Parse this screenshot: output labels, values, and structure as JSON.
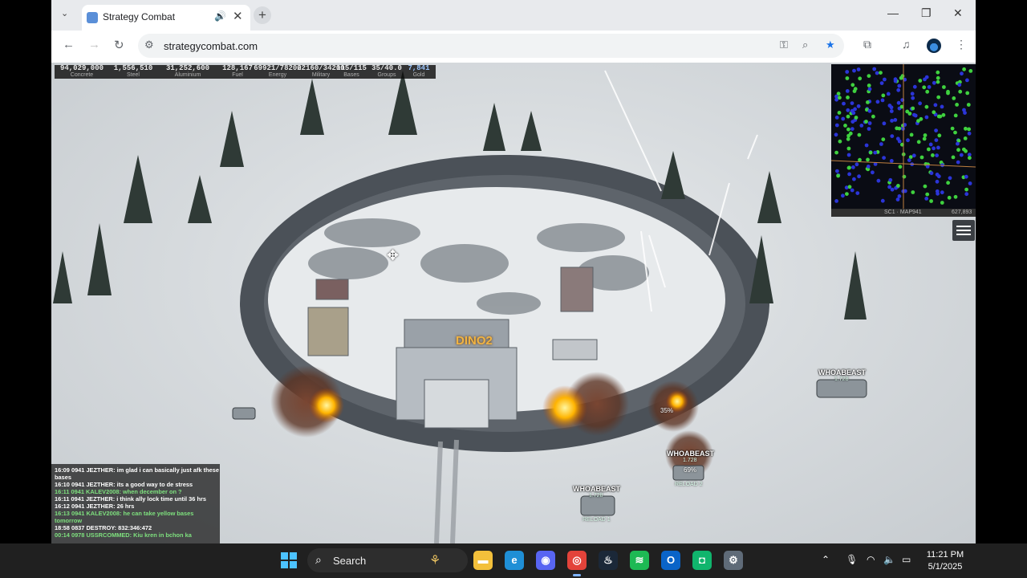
{
  "browser": {
    "tab": {
      "title": "Strategy Combat",
      "mute_icon": "speaker-icon",
      "close_glyph": "✕"
    },
    "new_tab_glyph": "+",
    "window_controls": {
      "minimize": "—",
      "restore": "❐",
      "close": "✕"
    },
    "url": "strategycombat.com"
  },
  "hud": {
    "resources": [
      {
        "value": "94,029,000",
        "label": "Concrete"
      },
      {
        "value": "1,556,510",
        "label": "Steel"
      },
      {
        "value": "31,252,600",
        "label": "Aluminium"
      },
      {
        "value": "128,167",
        "label": "Fuel"
      },
      {
        "value": "69921/78200",
        "label": "Energy"
      },
      {
        "value": "22160/34200",
        "label": "Military"
      },
      {
        "value": "115/115",
        "label": "Bases"
      },
      {
        "value": "35/40.0",
        "label": "Groups"
      },
      {
        "value": "7,841",
        "label": "Gold"
      }
    ]
  },
  "minimap": {
    "footer_left": "SC1 · MAP941",
    "footer_right": "627,893"
  },
  "chat": {
    "lines": [
      {
        "text": "16:09 0941 JEZTHER: im glad i can basically just afk these bases",
        "color": "#ffffff"
      },
      {
        "text": "16:10 0941 JEZTHER: its a good way to de stress",
        "color": "#ffffff"
      },
      {
        "text": "16:11 0941 KALEV2008: when december on ?",
        "color": "#7ee07e"
      },
      {
        "text": "16:11 0941 JEZTHER: i think ally lock time until 36 hrs",
        "color": "#ffffff"
      },
      {
        "text": "16:12 0941 JEZTHER: 26 hrs",
        "color": "#ffffff"
      },
      {
        "text": "16:13 0941 KALEV2008: he can take yellow bases tomorrow",
        "color": "#7ee07e"
      },
      {
        "text": "18:58 0837 DESTROY: 832:346:472",
        "color": "#ffffff"
      },
      {
        "text": "00:14 0978 USSRCOMMED: Kiu kren in bchon ka",
        "color": "#7ee07e"
      }
    ]
  },
  "units": [
    {
      "name": "WHOABEAST",
      "tag": "1.728",
      "status": ""
    },
    {
      "name": "WHOABEAST",
      "tag": "1.728",
      "status": "RELOAD 2"
    },
    {
      "name": "WHOABEAST",
      "tag": "1.728",
      "status": "RELOAD 1"
    }
  ],
  "base_label": "DINO2",
  "damage": {
    "a": "35%",
    "b": "69%"
  },
  "taskbar": {
    "search_placeholder": "Search",
    "apps": [
      {
        "name": "file-explorer",
        "glyph": "▬",
        "color": "#f3c03b"
      },
      {
        "name": "edge",
        "glyph": "e",
        "color": "#1f8fd6"
      },
      {
        "name": "discord",
        "glyph": "◉",
        "color": "#5865f2"
      },
      {
        "name": "chrome",
        "glyph": "◎",
        "color": "#e3433a"
      },
      {
        "name": "steam",
        "glyph": "♨",
        "color": "#1b2838"
      },
      {
        "name": "spotify",
        "glyph": "≋",
        "color": "#1db954"
      },
      {
        "name": "outlook",
        "glyph": "O",
        "color": "#0a64c8"
      },
      {
        "name": "teams-app",
        "glyph": "◘",
        "color": "#10b56d"
      },
      {
        "name": "settings",
        "glyph": "⚙",
        "color": "#5f6b78"
      }
    ],
    "time": "11:21 PM",
    "date": "5/1/2025"
  },
  "colors": {
    "snow": "#dfe3e6",
    "fire": "#ffb400",
    "smoke": "#6b4030",
    "minimap_bg": "#0a0c14"
  }
}
